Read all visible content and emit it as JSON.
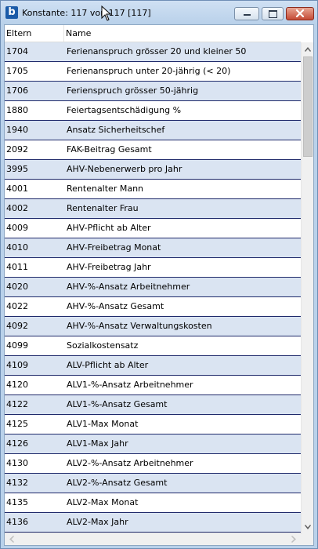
{
  "window": {
    "logo_letter": "b",
    "title": "Konstante: 117 von 117 [117]",
    "icons": [
      "minimize-icon",
      "maximize-icon",
      "close-icon"
    ]
  },
  "table": {
    "columns": [
      "Eltern",
      "Name"
    ],
    "rows": [
      {
        "id": "1704",
        "name": "Ferienanspruch grösser 20 und kleiner 50"
      },
      {
        "id": "1705",
        "name": "Ferienanspruch unter 20-jährig (< 20)"
      },
      {
        "id": "1706",
        "name": "Ferienspruch grösser 50-jährig"
      },
      {
        "id": "1880",
        "name": "Feiertagsentschädigung %"
      },
      {
        "id": "1940",
        "name": "Ansatz Sicherheitschef"
      },
      {
        "id": "2092",
        "name": "FAK-Beitrag Gesamt"
      },
      {
        "id": "3995",
        "name": "AHV-Nebenerwerb pro Jahr"
      },
      {
        "id": "4001",
        "name": "Rentenalter Mann"
      },
      {
        "id": "4002",
        "name": "Rentenalter Frau"
      },
      {
        "id": "4009",
        "name": "AHV-Pflicht ab Alter"
      },
      {
        "id": "4010",
        "name": "AHV-Freibetrag Monat"
      },
      {
        "id": "4011",
        "name": "AHV-Freibetrag Jahr"
      },
      {
        "id": "4020",
        "name": "AHV-%-Ansatz Arbeitnehmer"
      },
      {
        "id": "4022",
        "name": "AHV-%-Ansatz Gesamt"
      },
      {
        "id": "4092",
        "name": "AHV-%-Ansatz Verwaltungskosten"
      },
      {
        "id": "4099",
        "name": "Sozialkostensatz"
      },
      {
        "id": "4109",
        "name": "ALV-Pflicht ab Alter"
      },
      {
        "id": "4120",
        "name": "ALV1-%-Ansatz Arbeitnehmer"
      },
      {
        "id": "4122",
        "name": "ALV1-%-Ansatz Gesamt"
      },
      {
        "id": "4125",
        "name": "ALV1-Max Monat"
      },
      {
        "id": "4126",
        "name": "ALV1-Max Jahr"
      },
      {
        "id": "4130",
        "name": "ALV2-%-Ansatz Arbeitnehmer"
      },
      {
        "id": "4132",
        "name": "ALV2-%-Ansatz Gesamt"
      },
      {
        "id": "4135",
        "name": "ALV2-Max Monat"
      },
      {
        "id": "4136",
        "name": "ALV2-Max Jahr"
      }
    ]
  },
  "colors": {
    "title_bar": "#b9d1ea",
    "row_alt": "#dae4f2",
    "row_separator": "#1f2a6b",
    "close_button": "#c54a35"
  }
}
